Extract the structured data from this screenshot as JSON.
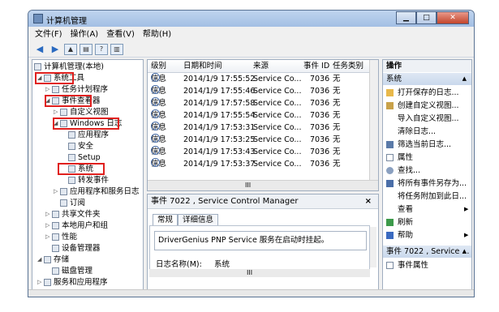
{
  "window": {
    "title": "计算机管理"
  },
  "menu": [
    "文件(F)",
    "操作(A)",
    "查看(V)",
    "帮助(H)"
  ],
  "tree": [
    {
      "label": "计算机管理(本地)",
      "depth": 0
    },
    {
      "label": "系统工具",
      "depth": 1
    },
    {
      "label": "任务计划程序",
      "depth": 2
    },
    {
      "label": "事件查看器",
      "depth": 2
    },
    {
      "label": "自定义视图",
      "depth": 3
    },
    {
      "label": "Windows 日志",
      "depth": 3
    },
    {
      "label": "应用程序",
      "depth": 4
    },
    {
      "label": "安全",
      "depth": 4
    },
    {
      "label": "Setup",
      "depth": 4
    },
    {
      "label": "系统",
      "depth": 4
    },
    {
      "label": "转发事件",
      "depth": 4
    },
    {
      "label": "应用程序和服务日志",
      "depth": 3
    },
    {
      "label": "订阅",
      "depth": 3
    },
    {
      "label": "共享文件夹",
      "depth": 2
    },
    {
      "label": "本地用户和组",
      "depth": 2
    },
    {
      "label": "性能",
      "depth": 2
    },
    {
      "label": "设备管理器",
      "depth": 2
    },
    {
      "label": "存储",
      "depth": 1
    },
    {
      "label": "磁盘管理",
      "depth": 2
    },
    {
      "label": "服务和应用程序",
      "depth": 1
    }
  ],
  "events": {
    "columns": [
      "级别",
      "日期和时间",
      "来源",
      "事件 ID",
      "任务类别"
    ],
    "rows": [
      [
        "信息",
        "2014/1/9 17:55:52",
        "Service Co...",
        "7036",
        "无"
      ],
      [
        "信息",
        "2014/1/9 17:55:46",
        "Service Co...",
        "7036",
        "无"
      ],
      [
        "信息",
        "2014/1/9 17:57:58",
        "Service Co...",
        "7036",
        "无"
      ],
      [
        "信息",
        "2014/1/9 17:55:54",
        "Service Co...",
        "7036",
        "无"
      ],
      [
        "信息",
        "2014/1/9 17:53:31",
        "Service Co...",
        "7036",
        "无"
      ],
      [
        "信息",
        "2014/1/9 17:53:25",
        "Service Co...",
        "7036",
        "无"
      ],
      [
        "信息",
        "2014/1/9 17:53:43",
        "Service Co...",
        "7036",
        "无"
      ],
      [
        "信息",
        "2014/1/9 17:53:37",
        "Service Co...",
        "7036",
        "无"
      ]
    ],
    "scroll_marker": "III"
  },
  "detail": {
    "title": "事件 7022 , Service Control Manager",
    "close": "×",
    "tabs": [
      "常规",
      "详细信息"
    ],
    "message": "DriverGenius PNP Service 服务在启动时挂起。",
    "log_name_label": "日志名称(M):",
    "log_name_value": "系统",
    "scroll_marker": "III"
  },
  "actions": {
    "header": "操作",
    "section1": "系统",
    "items1": [
      "打开保存的日志...",
      "创建自定义视图...",
      "导入自定义视图...",
      "清除日志...",
      "筛选当前日志...",
      "属性",
      "查找...",
      "将所有事件另存为...",
      "将任务附加到此日...",
      "查看",
      "刷新",
      "帮助"
    ],
    "section2": "事件 7022 , Service ...",
    "items2": [
      "事件属性"
    ]
  },
  "colors": {
    "highlight": "#e0201e",
    "section": "#c9d8ec"
  }
}
